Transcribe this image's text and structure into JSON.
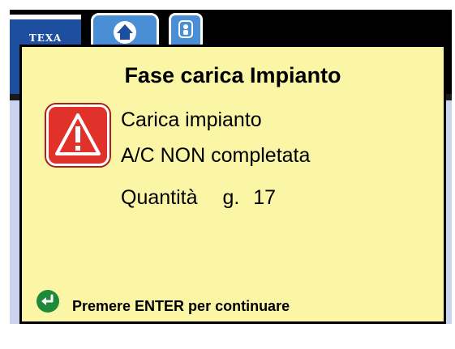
{
  "app": {
    "logo_text": "TEXA"
  },
  "dialog": {
    "title": "Fase carica Impianto",
    "message_line1": "Carica impianto",
    "message_line2": "A/C NON completata",
    "quantity_label": "Quantità",
    "quantity_unit": "g.",
    "quantity_value": "17",
    "hint": "Premere ENTER per continuare",
    "icon": "warning-icon",
    "enter_icon": "enter-icon"
  },
  "colors": {
    "dialog_background": "#fbf6a6",
    "warning_red": "#e0322a",
    "enter_green": "#1d8a3a",
    "brand_blue": "#1d4f9e",
    "tab_blue": "#4a8fd6",
    "app_background": "#cbd3ee"
  }
}
